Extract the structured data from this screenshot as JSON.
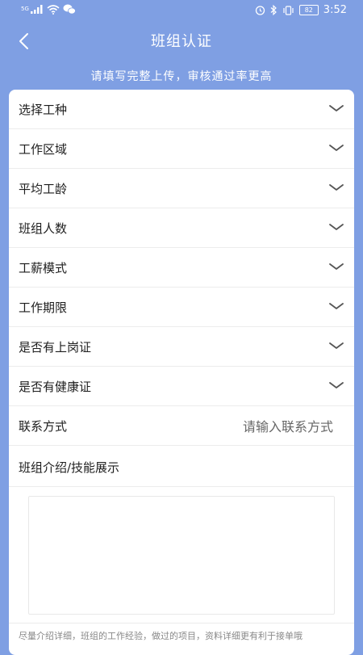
{
  "status_bar": {
    "network": "5G",
    "battery": "82",
    "time": "3:52"
  },
  "header": {
    "title": "班组认证"
  },
  "hint": "请填写完整上传，审核通过率更高",
  "form": {
    "dropdowns": [
      {
        "label": "选择工种"
      },
      {
        "label": "工作区域"
      },
      {
        "label": "平均工龄"
      },
      {
        "label": "班组人数"
      },
      {
        "label": "工薪模式"
      },
      {
        "label": "工作期限"
      },
      {
        "label": "是否有上岗证"
      },
      {
        "label": "是否有健康证"
      }
    ],
    "contact": {
      "label": "联系方式",
      "placeholder": "请输入联系方式",
      "value": ""
    },
    "intro": {
      "label": "班组介绍/技能展示",
      "value": ""
    },
    "footnote": "尽量介绍详细，班组的工作经验，做过的项目，资料详细更有利于接单哦"
  },
  "colors": {
    "background": "#7f9fe3",
    "card": "#ffffff",
    "text": "#1e1e1e",
    "muted": "#888888"
  }
}
